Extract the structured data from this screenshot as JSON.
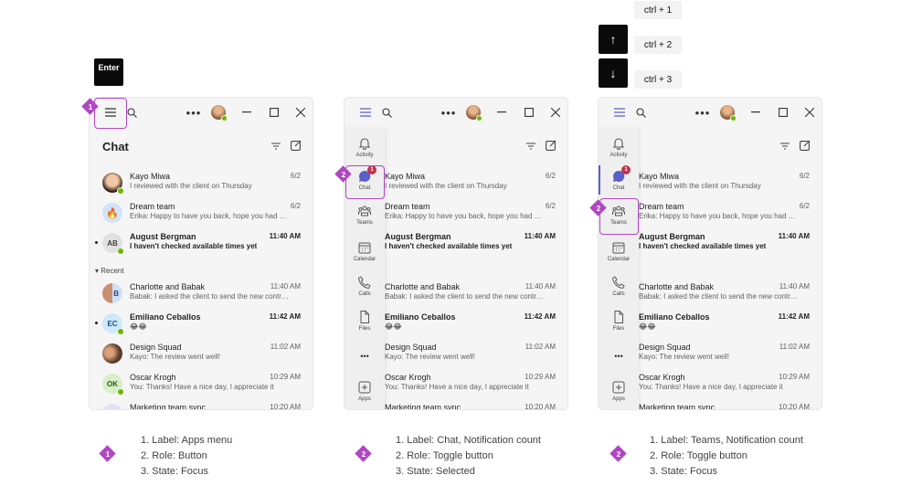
{
  "keys": {
    "enter": "Enter",
    "up": "↑",
    "down": "↓",
    "shortcuts": [
      "ctrl + 1",
      "ctrl + 2",
      "ctrl + 3"
    ]
  },
  "chat_header": {
    "title": "Chat"
  },
  "section_recent": "▾ Recent",
  "chats": [
    {
      "name": "Kayo Miwa",
      "message": "I reviewed with the client on Thursday",
      "time": "6/2",
      "bold": false,
      "initials": ""
    },
    {
      "name": "Dream team",
      "message": "Erika: Happy to have you back, hope you had a great vacation",
      "time": "6/2",
      "bold": false,
      "initials": ""
    },
    {
      "name": "August Bergman",
      "message": "I haven't checked available times yet",
      "time": "11:40 AM",
      "bold": true,
      "initials": "AB"
    },
    {
      "name": "Charlotte and Babak",
      "message": "Babak: I asked the client to send the new contract",
      "time": "11:40 AM",
      "bold": false,
      "initials": "B"
    },
    {
      "name": "Emiliano Ceballos",
      "message": "😂😂",
      "time": "11:42 AM",
      "bold": true,
      "initials": "EC"
    },
    {
      "name": "Design Squad",
      "message": "Kayo: The review went well!",
      "time": "11:02 AM",
      "bold": false,
      "initials": ""
    },
    {
      "name": "Oscar Krogh",
      "message": "You: Thanks! Have a nice day, I appreciate it",
      "time": "10:29 AM",
      "bold": false,
      "initials": "OK"
    },
    {
      "name": "Marketing team sync",
      "message": "",
      "time": "10:20 AM",
      "bold": false,
      "initials": ""
    }
  ],
  "chats_cropped": [
    "Kayo Miwa",
    "Dream team",
    "August Bergman",
    "Charlotte and Babak",
    "Emiliano Ceballos",
    "Design Squad",
    "Oscar Krogh",
    "Marketing team sync"
  ],
  "app_bar": [
    {
      "label": "Activity",
      "icon": "bell-icon"
    },
    {
      "label": "Chat",
      "icon": "chat-icon",
      "badge": "1"
    },
    {
      "label": "Teams",
      "icon": "teams-icon"
    },
    {
      "label": "Calendar",
      "icon": "calendar-icon"
    },
    {
      "label": "Calls",
      "icon": "phone-icon"
    },
    {
      "label": "Files",
      "icon": "file-icon"
    },
    {
      "label": "•••",
      "icon": "more-icon"
    },
    {
      "label": "Apps",
      "icon": "add-apps-icon"
    }
  ],
  "markers": [
    "1",
    "2",
    "2"
  ],
  "legends": [
    [
      "1. Label: Apps menu",
      "2. Role: Button",
      "3. State: Focus"
    ],
    [
      "1. Label: Chat, Notification count",
      "2. Role: Toggle button",
      "3. State: Selected"
    ],
    [
      "1. Label: Teams, Notification count",
      "2. Role: Toggle button",
      "3. State: Focus"
    ]
  ],
  "colors": {
    "focus": "#b146c2",
    "brand": "#5b5fc7",
    "presence_available": "#6bb700",
    "badge": "#c4314b"
  }
}
